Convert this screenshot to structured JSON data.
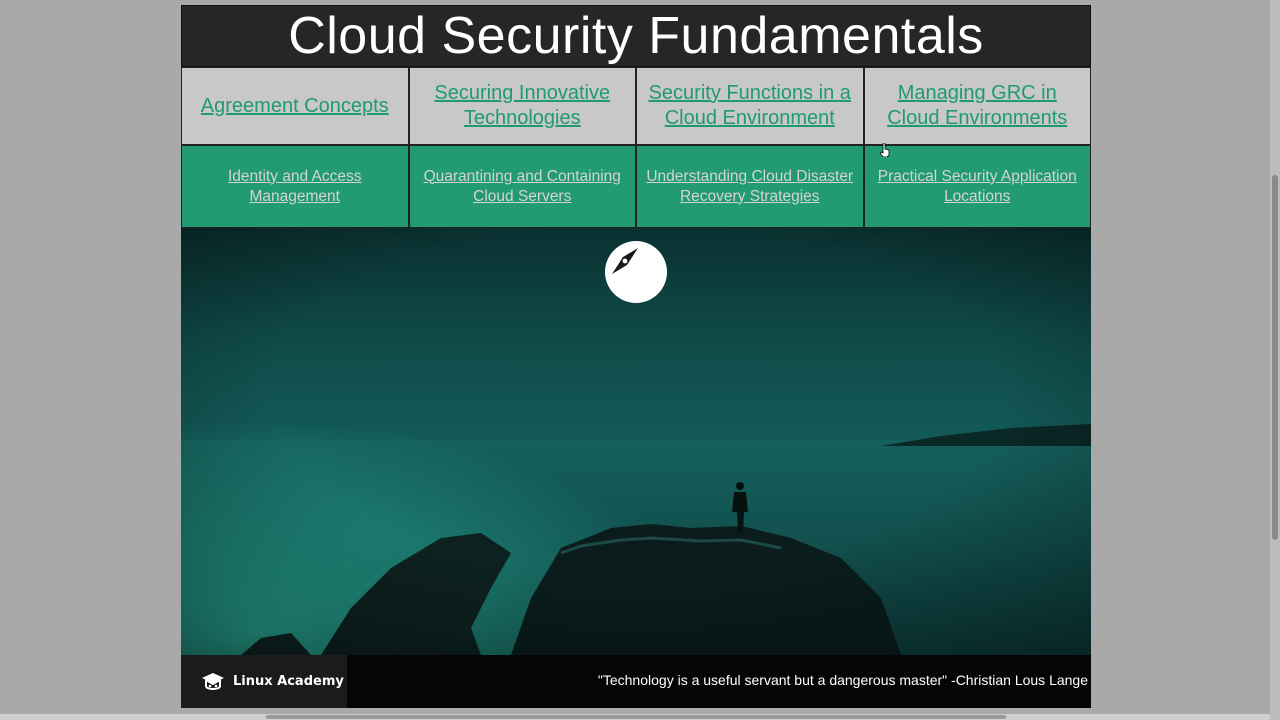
{
  "title": "Cloud Security Fundamentals",
  "top_links": [
    {
      "label": "Agreement Concepts"
    },
    {
      "label": "Securing Innovative Technologies"
    },
    {
      "label": "Security Functions in a Cloud Environment"
    },
    {
      "label": "Managing GRC in Cloud Environments"
    }
  ],
  "bottom_links": [
    {
      "label": "Identity and Access Management"
    },
    {
      "label": "Quarantining and Containing Cloud Servers"
    },
    {
      "label": "Understanding Cloud Disaster Recovery Strategies"
    },
    {
      "label": "Practical Security Application Locations"
    }
  ],
  "hero": {
    "icon": "compass-icon"
  },
  "footer": {
    "brand": "Linux Academy",
    "brand_icon": "graduation-cap-icon",
    "quote": "\"Technology is a useful servant but a dangerous master\" -Christian Lous Lange"
  },
  "colors": {
    "accent_green": "#229a72",
    "link_green": "#1f9a72",
    "title_bg": "#262626",
    "top_row_bg": "#c8c8c8"
  }
}
